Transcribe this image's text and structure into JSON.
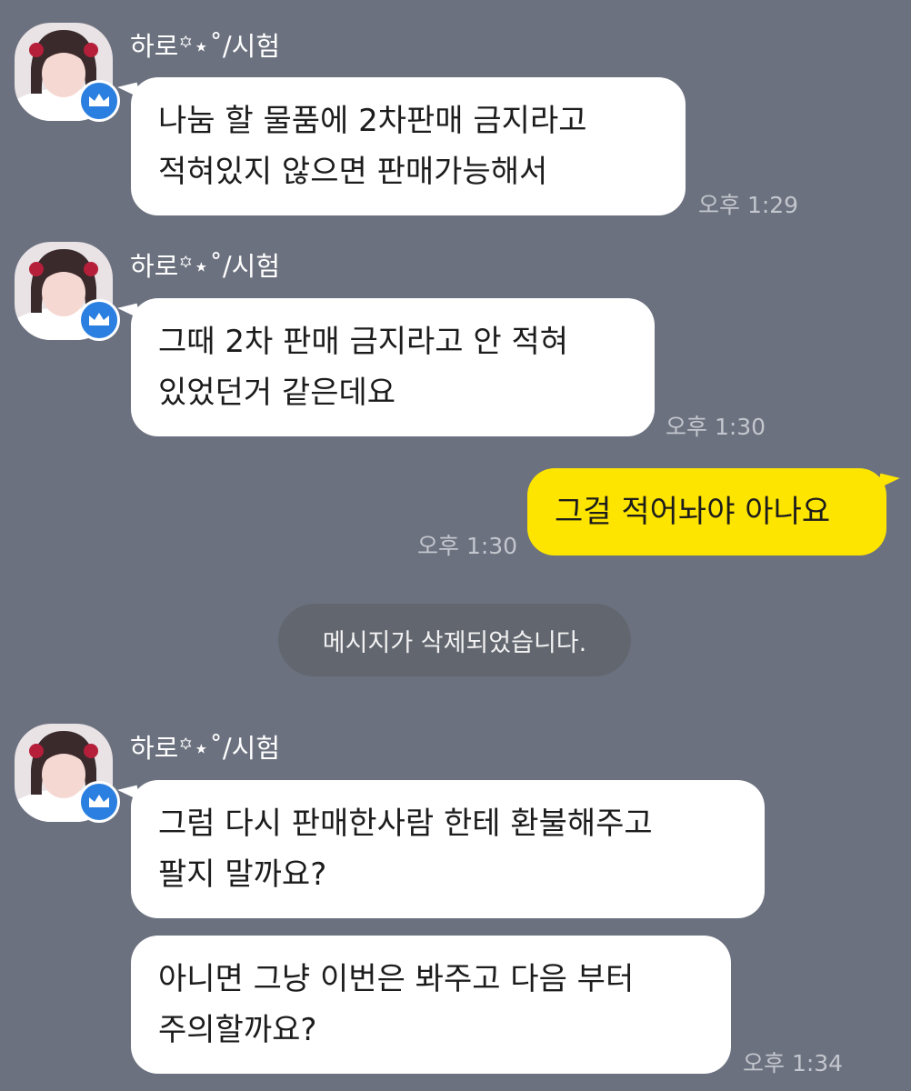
{
  "sender_name": "하로꙳⋆˚/시험",
  "messages": [
    {
      "text": " 나눔 할 물품에 2차판매 금지라고\n적혀있지 않으면  판매가능해서",
      "time": "오후 1:29"
    },
    {
      "text": "그때 2차 판매 금지라고 안 적혀\n있었던거 같은데요",
      "time": "오후 1:30"
    },
    {
      "text": "그걸 적어놔야 아나요",
      "time": "오후 1:30"
    },
    {
      "text": "메시지가 삭제되었습니다."
    },
    {
      "text": "그럼  다시 판매한사람 한테 환불해주고\n팔지 말까요?"
    },
    {
      "text": "아니면 그냥 이번은 봐주고 다음 부터\n주의할까요?",
      "time": "오후 1:34"
    }
  ],
  "colors": {
    "background": "#6c717f",
    "incoming_bubble": "#ffffff",
    "outgoing_bubble": "#fee500",
    "badge": "#2a7fe0"
  },
  "icons": {
    "avatar": "profile-photo",
    "badge": "crown-icon"
  }
}
